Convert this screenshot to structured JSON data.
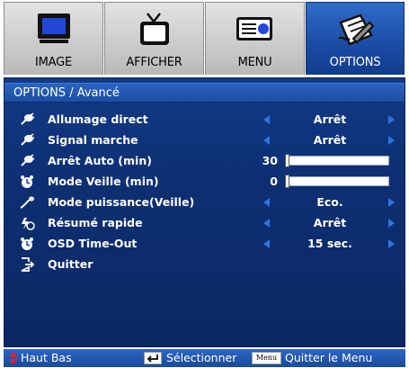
{
  "tabs": [
    {
      "label": "IMAGE",
      "icon": "monitor-icon",
      "active": false
    },
    {
      "label": "AFFICHER",
      "icon": "tv-icon",
      "active": false
    },
    {
      "label": "MENU",
      "icon": "projector-icon",
      "active": false
    },
    {
      "label": "OPTIONS",
      "icon": "options-icon",
      "active": true
    }
  ],
  "panel": {
    "title": "OPTIONS / Avancé",
    "rows": [
      {
        "label": "Allumage direct",
        "icon": "power-plug-icon",
        "type": "select",
        "value": "Arrêt"
      },
      {
        "label": "Signal marche",
        "icon": "power-plug-icon",
        "type": "select",
        "value": "Arrêt"
      },
      {
        "label": "Arrêt Auto (min)",
        "icon": "power-plug-icon",
        "type": "slider",
        "value": "30",
        "level": 0
      },
      {
        "label": "Mode Veille (min)",
        "icon": "alarm-clock-icon",
        "type": "slider",
        "value": "0",
        "level": 0
      },
      {
        "label": "Mode puissance(Veille)",
        "icon": "power-line-icon",
        "type": "select",
        "value": "Eco."
      },
      {
        "label": "Résumé rapide",
        "icon": "quick-resume-icon",
        "type": "select",
        "value": "Arrêt"
      },
      {
        "label": "OSD Time-Out",
        "icon": "alarm-clock-icon",
        "type": "select",
        "value": "15 sec."
      },
      {
        "label": "Quitter",
        "icon": "exit-icon",
        "type": "action",
        "value": ""
      }
    ]
  },
  "bottom": {
    "nav_label": "Haut Bas",
    "select_label": "Sélectionner",
    "menu_key": "Menu",
    "exit_label": "Quitter le Menu"
  },
  "colors": {
    "accent": "#1d4da3",
    "arrow": "#2d74e0",
    "nav_arrow": "#e3222c"
  }
}
